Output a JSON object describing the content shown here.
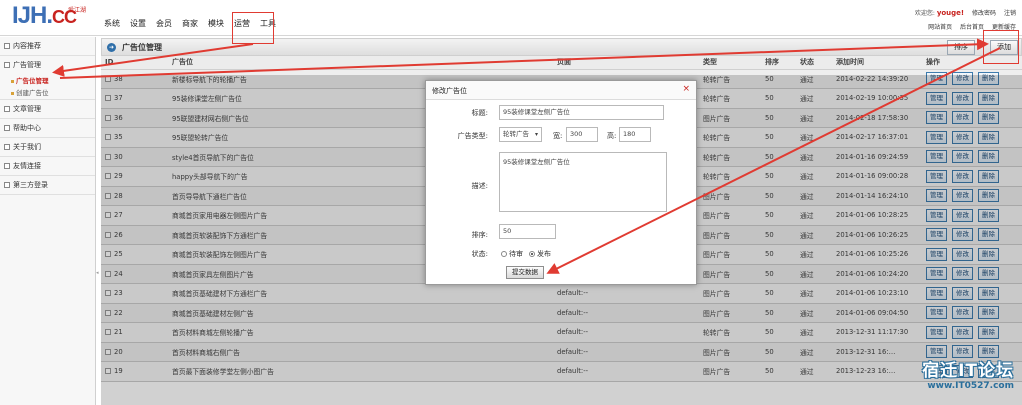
{
  "logo": {
    "main": "IJH.",
    "cc": "CC",
    "sub": "爱江湖"
  },
  "top_nav": [
    "系统",
    "设置",
    "会员",
    "商家",
    "模块",
    "运营",
    "工具"
  ],
  "top_right": {
    "welcome": "欢迎您:",
    "user": "youge!",
    "modify_password": "修改密码",
    "logout": "注销",
    "site_home": "网站首页",
    "admin_home": "后台首页",
    "update_cache": "更新缓存"
  },
  "sidebar": {
    "items": [
      {
        "label": "内容推荐"
      },
      {
        "label": "广告管理"
      },
      {
        "label": "文章管理"
      },
      {
        "label": "帮助中心"
      },
      {
        "label": "关于我们"
      },
      {
        "label": "友情连接"
      },
      {
        "label": "第三方登录"
      }
    ],
    "sub_items": [
      {
        "label": "广告位管理"
      },
      {
        "label": "创建广告位"
      }
    ]
  },
  "main": {
    "title": "广告位管理",
    "btn_sort": "排序",
    "btn_add": "添加",
    "columns": [
      "ID",
      "广告位",
      "页面",
      "类型",
      "排序",
      "状态",
      "添加时间",
      "操作"
    ],
    "ops": [
      "管理",
      "修改",
      "删除"
    ],
    "rows": [
      {
        "id": "38",
        "name": "新楼标导航下的轮播广告",
        "page": "",
        "type": "轮转广告",
        "sort": "50",
        "status": "通过",
        "time": "2014-02-22 14:39:20"
      },
      {
        "id": "37",
        "name": "95装修课堂左侧广告位",
        "page": "",
        "type": "轮转广告",
        "sort": "50",
        "status": "通过",
        "time": "2014-02-19 10:00:35"
      },
      {
        "id": "36",
        "name": "95联盟建材网右侧广告位",
        "page": "",
        "type": "图片广告",
        "sort": "50",
        "status": "通过",
        "time": "2014-02-18 17:58:30"
      },
      {
        "id": "35",
        "name": "95联盟轮转广告位",
        "page": "",
        "type": "轮转广告",
        "sort": "50",
        "status": "通过",
        "time": "2014-02-17 16:37:01"
      },
      {
        "id": "30",
        "name": "style4首页导航下的广告位",
        "page": "",
        "type": "轮转广告",
        "sort": "50",
        "status": "通过",
        "time": "2014-01-16 09:24:59"
      },
      {
        "id": "29",
        "name": "happy头部导航下的广告",
        "page": "",
        "type": "轮转广告",
        "sort": "50",
        "status": "通过",
        "time": "2014-01-16 09:00:28"
      },
      {
        "id": "28",
        "name": "首页导导航下通栏广告位",
        "page": "",
        "type": "图片广告",
        "sort": "50",
        "status": "通过",
        "time": "2014-01-14 16:24:10"
      },
      {
        "id": "27",
        "name": "商城首页家用电器左侧图片广告",
        "page": "",
        "type": "图片广告",
        "sort": "50",
        "status": "通过",
        "time": "2014-01-06 10:28:25"
      },
      {
        "id": "26",
        "name": "商城首页软装配饰下方通栏广告",
        "page": "",
        "type": "图片广告",
        "sort": "50",
        "status": "通过",
        "time": "2014-01-06 10:26:25"
      },
      {
        "id": "25",
        "name": "商城首页软装配饰左侧图片广告",
        "page": "",
        "type": "图片广告",
        "sort": "50",
        "status": "通过",
        "time": "2014-01-06 10:25:26"
      },
      {
        "id": "24",
        "name": "商城首页家具左侧图片广告",
        "page": "default:--",
        "type": "图片广告",
        "sort": "50",
        "status": "通过",
        "time": "2014-01-06 10:24:20"
      },
      {
        "id": "23",
        "name": "商城首页基础建材下方通栏广告",
        "page": "default:--",
        "type": "图片广告",
        "sort": "50",
        "status": "通过",
        "time": "2014-01-06 10:23:10"
      },
      {
        "id": "22",
        "name": "商城首页基础建材左侧广告",
        "page": "default:--",
        "type": "图片广告",
        "sort": "50",
        "status": "通过",
        "time": "2014-01-06 09:04:50"
      },
      {
        "id": "21",
        "name": "首页材料商城左侧轮播广告",
        "page": "default:--",
        "type": "轮转广告",
        "sort": "50",
        "status": "通过",
        "time": "2013-12-31 11:17:30"
      },
      {
        "id": "20",
        "name": "首页材料商城右侧广告",
        "page": "default:--",
        "type": "图片广告",
        "sort": "50",
        "status": "通过",
        "time": "2013-12-31 16:…"
      },
      {
        "id": "19",
        "name": "首页最下面装修学堂左侧小图广告",
        "page": "default:--",
        "type": "图片广告",
        "sort": "50",
        "status": "通过",
        "time": "2013-12-23 16:…"
      }
    ]
  },
  "dialog": {
    "title": "修改广告位",
    "close": "×",
    "label_title": "标题:",
    "value_title": "95装修课堂左侧广告位",
    "label_type": "广告类型:",
    "value_type": "轮转广告",
    "label_width": "宽:",
    "value_width": "300",
    "label_height": "高:",
    "value_height": "180",
    "label_desc": "描述:",
    "value_desc": "95装修课堂左侧广告位",
    "label_sort": "排序:",
    "value_sort": "50",
    "label_status": "状态:",
    "status_pending": "待审",
    "status_publish": "发布",
    "submit": "提交数据"
  },
  "watermark": {
    "title": "宿迁IT论坛",
    "url": "www.IT0527.com"
  },
  "colors": {
    "brand_blue": "#3d6fb5",
    "brand_red": "#c8231f",
    "annotation_red": "#e03b32",
    "op_border": "#3e7cae"
  }
}
